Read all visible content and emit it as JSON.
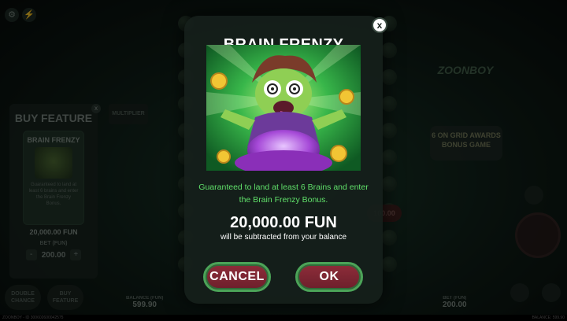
{
  "background": {
    "buy_panel": {
      "title": "BUY FEATURE",
      "card_title": "BRAIN FRENZY",
      "card_text": "Guaranteed to land at least 6 brains and enter the Brain Frenzy Bonus.",
      "card_price": "20,000.00 FUN",
      "bet_label": "BET (FUN)",
      "bet_value": "200.00",
      "minus": "-",
      "plus": "+",
      "close": "x"
    },
    "multiplier_tag": "MULTIPLIER",
    "logo": "ZOONBOY",
    "grid_promo": "6 ON GRID AWARDS BONUS GAME",
    "multiplier_badge": "100.00",
    "bottom_buttons": [
      "DOUBLE CHANCE",
      "BUY FEATURE"
    ],
    "balance_left": {
      "label": "BALANCE (FUN)",
      "value": "599.90"
    },
    "bet_right": {
      "label": "BET (FUN)",
      "value": "200.00"
    },
    "footer_left": "ZOONBOY - ID 300602600042575",
    "footer_right": "BALANCE: 599.90"
  },
  "modal": {
    "title": "BRAIN FRENZY",
    "close_label": "x",
    "description": "Guaranteed to land at least 6 Brains and enter the Brain Frenzy Bonus.",
    "price": "20,000.00 FUN",
    "note": "will be subtracted from your balance",
    "cancel_label": "CANCEL",
    "ok_label": "OK"
  },
  "colors": {
    "accent_green": "#60e06a",
    "button_red": "#8e2d3a",
    "button_border": "#4ba458"
  }
}
